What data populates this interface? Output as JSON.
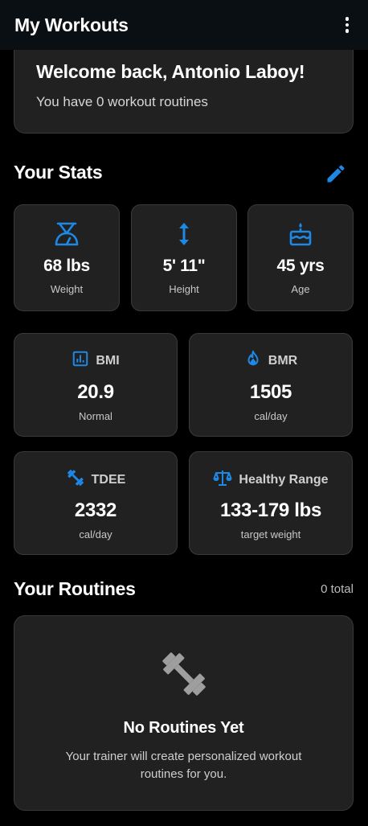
{
  "appbar": {
    "title": "My Workouts",
    "more_icon": "more-vert-icon"
  },
  "welcome": {
    "title": "Welcome back, Antonio Laboy!",
    "subtitle": "You have 0 workout routines"
  },
  "stats": {
    "title": "Your Stats",
    "edit_icon": "edit-icon",
    "accent": "#1e88e5",
    "weight": {
      "value": "68 lbs",
      "label": "Weight",
      "icon": "scale-icon"
    },
    "height": {
      "value": "5' 11\"",
      "label": "Height",
      "icon": "height-arrows-icon"
    },
    "age": {
      "value": "45 yrs",
      "label": "Age",
      "icon": "cake-icon"
    },
    "bmi": {
      "title": "BMI",
      "value": "20.9",
      "label": "Normal",
      "icon": "bar-chart-icon"
    },
    "bmr": {
      "title": "BMR",
      "value": "1505",
      "label": "cal/day",
      "icon": "flame-icon"
    },
    "tdee": {
      "title": "TDEE",
      "value": "2332",
      "label": "cal/day",
      "icon": "dumbbell-icon"
    },
    "healthy": {
      "title": "Healthy Range",
      "value": "133-179 lbs",
      "label": "target weight",
      "icon": "balance-scale-icon"
    }
  },
  "routines": {
    "title": "Your Routines",
    "total": "0 total",
    "empty_icon": "dumbbell-icon",
    "empty_title": "No Routines Yet",
    "empty_desc": "Your trainer will create personalized workout routines for you."
  }
}
